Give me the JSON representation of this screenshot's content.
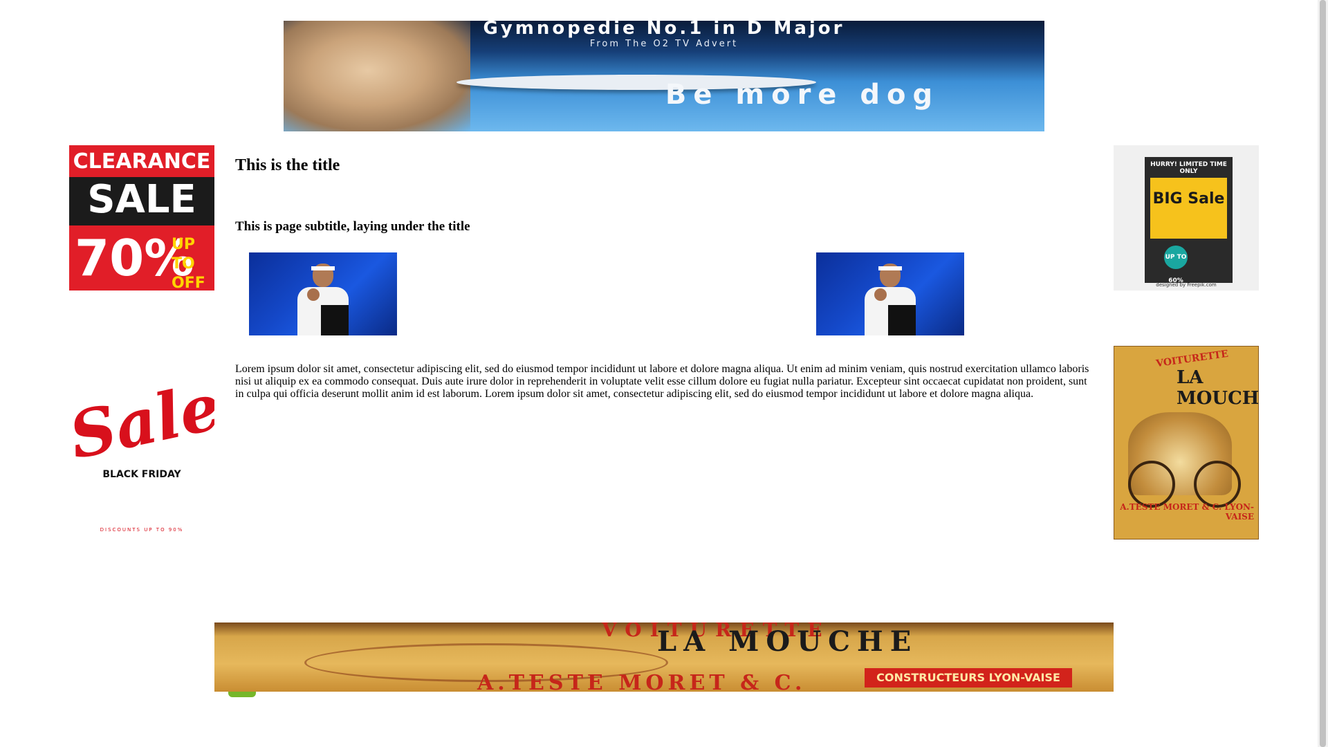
{
  "banner_top": {
    "headline": "Gymnopedie No.1 in D Major",
    "subline": "From The O2 TV Advert",
    "slogan": "Be more dog"
  },
  "ads": {
    "clearance": {
      "line1": "CLEARANCE",
      "line2": "SALE",
      "line3": "70%",
      "line4": "UP TO OFF"
    },
    "big_sale": {
      "top": "HURRY! LIMITED TIME ONLY",
      "main": "BIG Sale",
      "badge": "UP TO 60%",
      "credit": "designed by Freepik.com"
    },
    "black_friday": {
      "main": "Sale",
      "sub": "BLACK FRIDAY",
      "discount": "DISCOUNTS UP TO 90%"
    },
    "la_mouche": {
      "line1": "VOITURETTE",
      "line2": "LA MOUCHE",
      "line3": "A.TESTE MORET & C. LYON-VAISE"
    }
  },
  "content": {
    "title": "This is the title",
    "subtitle": "This is page subtitle, laying under the title",
    "body": "Lorem ipsum dolor sit amet, consectetur adipiscing elit, sed do eiusmod tempor incididunt ut labore et dolore magna aliqua. Ut enim ad minim veniam, quis nostrud exercitation ullamco laboris nisi ut aliquip ex ea commodo consequat. Duis aute irure dolor in reprehenderit in voluptate velit esse cillum dolore eu fugiat nulla pariatur. Excepteur sint occaecat cupidatat non proident, sunt in culpa qui officia deserunt mollit anim id est laborum. Lorem ipsum dolor sit amet, consectetur adipiscing elit, sed do eiusmod tempor incididunt ut labore et dolore magna aliqua."
  },
  "banner_bottom": {
    "line1": "VOITURETTE",
    "line2": "LA MOUCHE",
    "line3": "A.TESTE MORET & C.",
    "tag": "CONSTRUCTEURS LYON-VAISE"
  }
}
